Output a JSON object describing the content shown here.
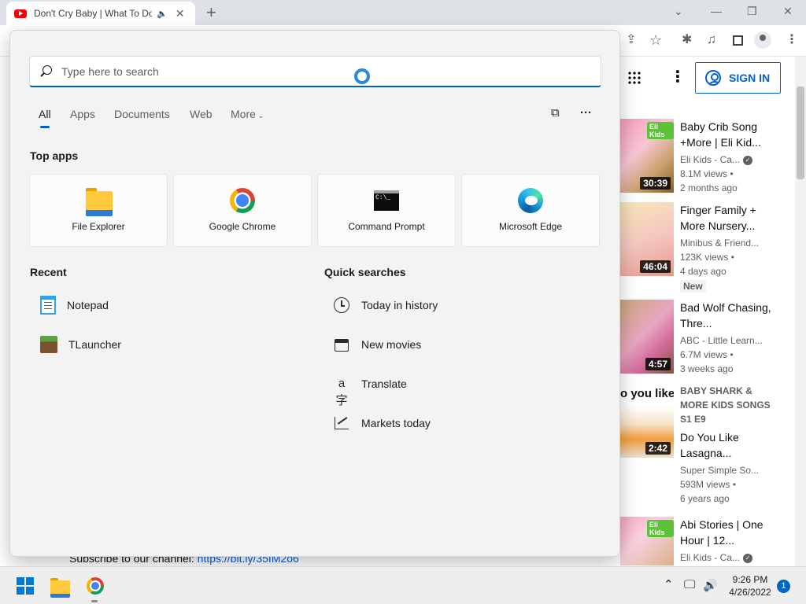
{
  "browser": {
    "tab_title": "Don't Cry Baby | What To Do",
    "tab_audio": "🔈",
    "tab_close": "✕",
    "new_tab": "+",
    "window_controls": {
      "collapse": "⌄",
      "minimize": "—",
      "restore": "❐",
      "close": "✕"
    },
    "toolbar_icons": {
      "share": "⇪",
      "bookmark": "☆",
      "extensions": "✱",
      "media": "♫",
      "menu": "⋮"
    }
  },
  "youtube": {
    "more": "⋮",
    "sign_in": "SIGN IN",
    "subscribe_text": "Subscribe to our channel:",
    "subscribe_link": "https://bit.ly/35IM2o6",
    "videos": [
      {
        "title": "Baby Crib Song +More | Eli Kid...",
        "channel": "Eli Kids - Ca...",
        "verified": true,
        "views": "8.1M views •",
        "age": "2 months ago",
        "duration": "30:39",
        "logo": "Eli Kids"
      },
      {
        "title": "Finger Family + More Nursery...",
        "channel": "Minibus & Friend...",
        "verified": false,
        "views": "123K views •",
        "age": "4 days ago",
        "badge": "New",
        "duration": "46:04"
      },
      {
        "title": "Bad Wolf Chasing, Thre...",
        "channel": "ABC - Little Learn...",
        "verified": false,
        "views": "6.7M views •",
        "age": "3 weeks ago",
        "duration": "4:57"
      },
      {
        "series": "BABY SHARK & MORE KIDS SONGS  S1 E9",
        "title": "Do You Like Lasagna...",
        "channel": "Super Simple So...",
        "verified": false,
        "views": "593M views •",
        "age": "6 years ago",
        "duration": "2:42",
        "thumb_text": "o you like"
      },
      {
        "title": "Abi Stories | One Hour | 12...",
        "channel": "Eli Kids - Ca...",
        "verified": true,
        "logo": "Eli Kids"
      }
    ]
  },
  "search": {
    "placeholder": "Type here to search",
    "tabs": [
      "All",
      "Apps",
      "Documents",
      "Web",
      "More"
    ],
    "more_chevron": "⌄",
    "icons": {
      "share": "⧉",
      "options": "···"
    },
    "top_apps_title": "Top apps",
    "top_apps": [
      "File Explorer",
      "Google Chrome",
      "Command Prompt",
      "Microsoft Edge"
    ],
    "cmd_glyph": "C:\\_",
    "recent_title": "Recent",
    "recent": [
      "Notepad",
      "TLauncher"
    ],
    "quick_title": "Quick searches",
    "quick": [
      "Today in history",
      "New movies",
      "Translate",
      "Markets today"
    ],
    "translate_glyph": "a字"
  },
  "taskbar": {
    "tray_chevron": "⌃",
    "tray_network": "🖵",
    "tray_volume": "🔊",
    "time": "9:26 PM",
    "date": "4/26/2022",
    "notifications": "1"
  }
}
